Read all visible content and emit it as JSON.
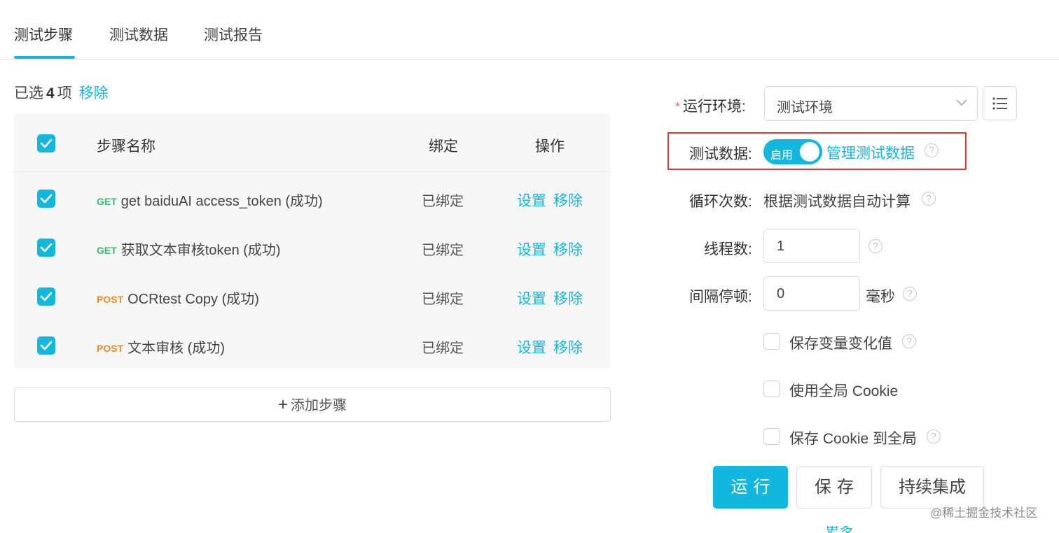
{
  "tabs": [
    {
      "label": "测试步骤",
      "active": true
    },
    {
      "label": "测试数据",
      "active": false
    },
    {
      "label": "测试报告",
      "active": false
    }
  ],
  "selection": {
    "prefix": "已选",
    "count": "4",
    "suffix": "项",
    "remove": "移除"
  },
  "table": {
    "headers": {
      "name": "步骤名称",
      "bound": "绑定",
      "ops": "操作"
    },
    "rows": [
      {
        "method": "GET",
        "name": "get baiduAI access_token (成功)",
        "bound": "已绑定",
        "set": "设置",
        "remove": "移除"
      },
      {
        "method": "GET",
        "name": "获取文本审核token (成功)",
        "bound": "已绑定",
        "set": "设置",
        "remove": "移除"
      },
      {
        "method": "POST",
        "name": "OCRtest Copy (成功)",
        "bound": "已绑定",
        "set": "设置",
        "remove": "移除"
      },
      {
        "method": "POST",
        "name": "文本审核 (成功)",
        "bound": "已绑定",
        "set": "设置",
        "remove": "移除"
      }
    ]
  },
  "add_step": {
    "icon": "plus-icon",
    "label": "添加步骤"
  },
  "form": {
    "env": {
      "required_mark": "*",
      "label": "运行环境:",
      "value": "测试环境"
    },
    "test_data": {
      "label": "测试数据:",
      "switch_text": "启用",
      "enabled": true,
      "manage_link": "管理测试数据"
    },
    "loops": {
      "label": "循环次数:",
      "value": "根据测试数据自动计算"
    },
    "threads": {
      "label": "线程数:",
      "value": "1"
    },
    "interval": {
      "label": "间隔停顿:",
      "value": "0",
      "unit": "毫秒"
    },
    "options": [
      {
        "label": "保存变量变化值",
        "checked": false,
        "help": true
      },
      {
        "label": "使用全局 Cookie",
        "checked": false,
        "help": false
      },
      {
        "label": "保存 Cookie 到全局",
        "checked": false,
        "help": true
      }
    ]
  },
  "actions": {
    "run": "运行",
    "save": "保存",
    "ci": "持续集成"
  },
  "watermark": "@稀土掘金技术社区",
  "bottom_link": "更多",
  "colors": {
    "accent": "#13b7dd",
    "get": "#3cb96c",
    "post": "#f08a24",
    "highlight_border": "#e53935"
  }
}
